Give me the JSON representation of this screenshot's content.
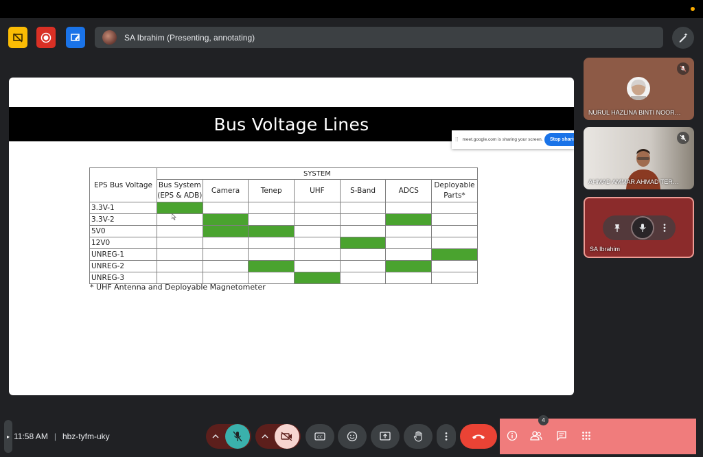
{
  "meeting": {
    "presenter_status": "SA Ibrahim (Presenting, annotating)",
    "time": "11:58 AM",
    "code": "hbz-tyfm-uky"
  },
  "slide": {
    "title": "Bus Voltage Lines",
    "table": {
      "corner_header": "EPS Bus Voltage",
      "group_header": "SYSTEM",
      "columns": [
        "Bus System (EPS & ADB)",
        "Camera",
        "Tenep",
        "UHF",
        "S-Band",
        "ADCS",
        "Deployable Parts*"
      ],
      "rows": [
        {
          "label": "3.3V-1",
          "on": [
            0
          ]
        },
        {
          "label": "3.3V-2",
          "on": [
            1,
            5
          ]
        },
        {
          "label": "5V0",
          "on": [
            1,
            2
          ]
        },
        {
          "label": "12V0",
          "on": [
            4
          ]
        },
        {
          "label": "UNREG-1",
          "on": [
            6
          ]
        },
        {
          "label": "UNREG-2",
          "on": [
            2,
            5
          ]
        },
        {
          "label": "UNREG-3",
          "on": [
            3
          ]
        }
      ]
    },
    "footnote": "* UHF Antenna and Deployable Magnetometer"
  },
  "share_banner": {
    "message": "meet.google.com is sharing your screen.",
    "stop_label": "Stop sharing"
  },
  "participants": [
    {
      "name": "NURUL HAZLINA BINTI NOOR…",
      "muted": true
    },
    {
      "name": "AHMAD AMMAR AHMAD TER…",
      "muted": true
    },
    {
      "name": "SA Ibrahim",
      "muted": false
    }
  ],
  "people_count": "4",
  "colors": {
    "cell_on": "#4aa32f",
    "leave_button": "#ea4335",
    "mic_button": "#3ab1ac",
    "panel_bg": "#f07c7c"
  }
}
